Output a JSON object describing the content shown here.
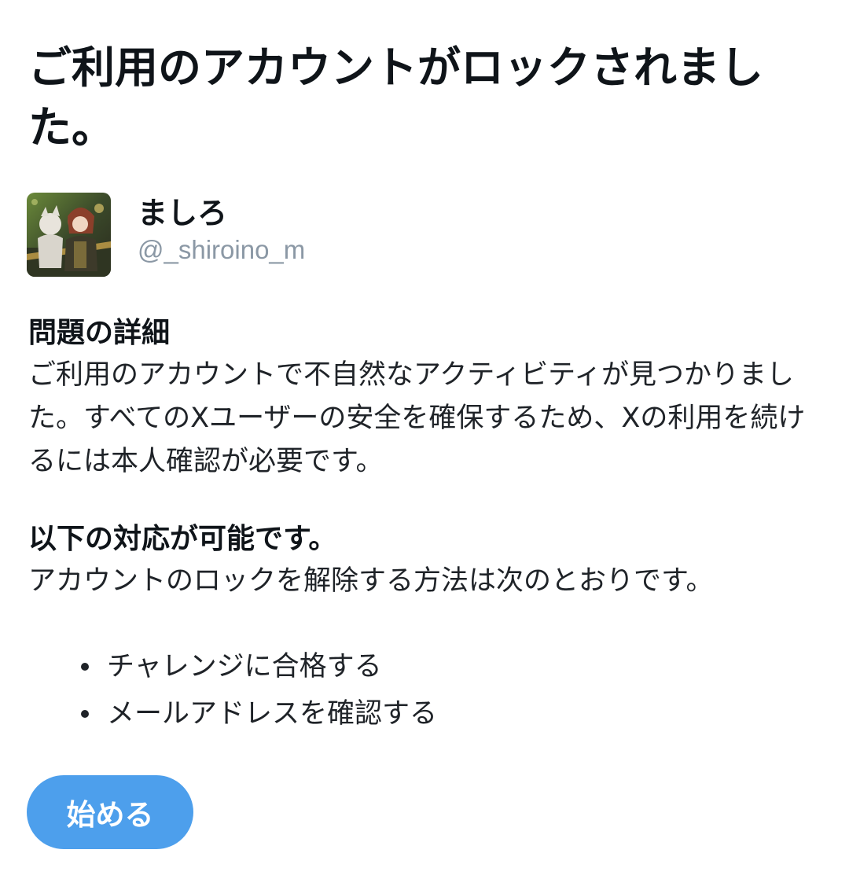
{
  "title": "ご利用のアカウントがロックされました。",
  "account": {
    "display_name": "ましろ",
    "handle": "@_shiroino_m",
    "avatar_icon": "user-avatar-image"
  },
  "details": {
    "heading": "問題の詳細",
    "body": "ご利用のアカウントで不自然なアクティビティが見つかりました。すべてのXユーザーの安全を確保するため、Xの利用を続けるには本人確認が必要です。"
  },
  "options": {
    "heading": "以下の対応が可能です。",
    "body": "アカウントのロックを解除する方法は次のとおりです。",
    "items": [
      {
        "label": "チャレンジに合格する"
      },
      {
        "label": "メールアドレスを確認する"
      }
    ]
  },
  "start_button": {
    "label": "始める",
    "color": "#4d9fec"
  }
}
